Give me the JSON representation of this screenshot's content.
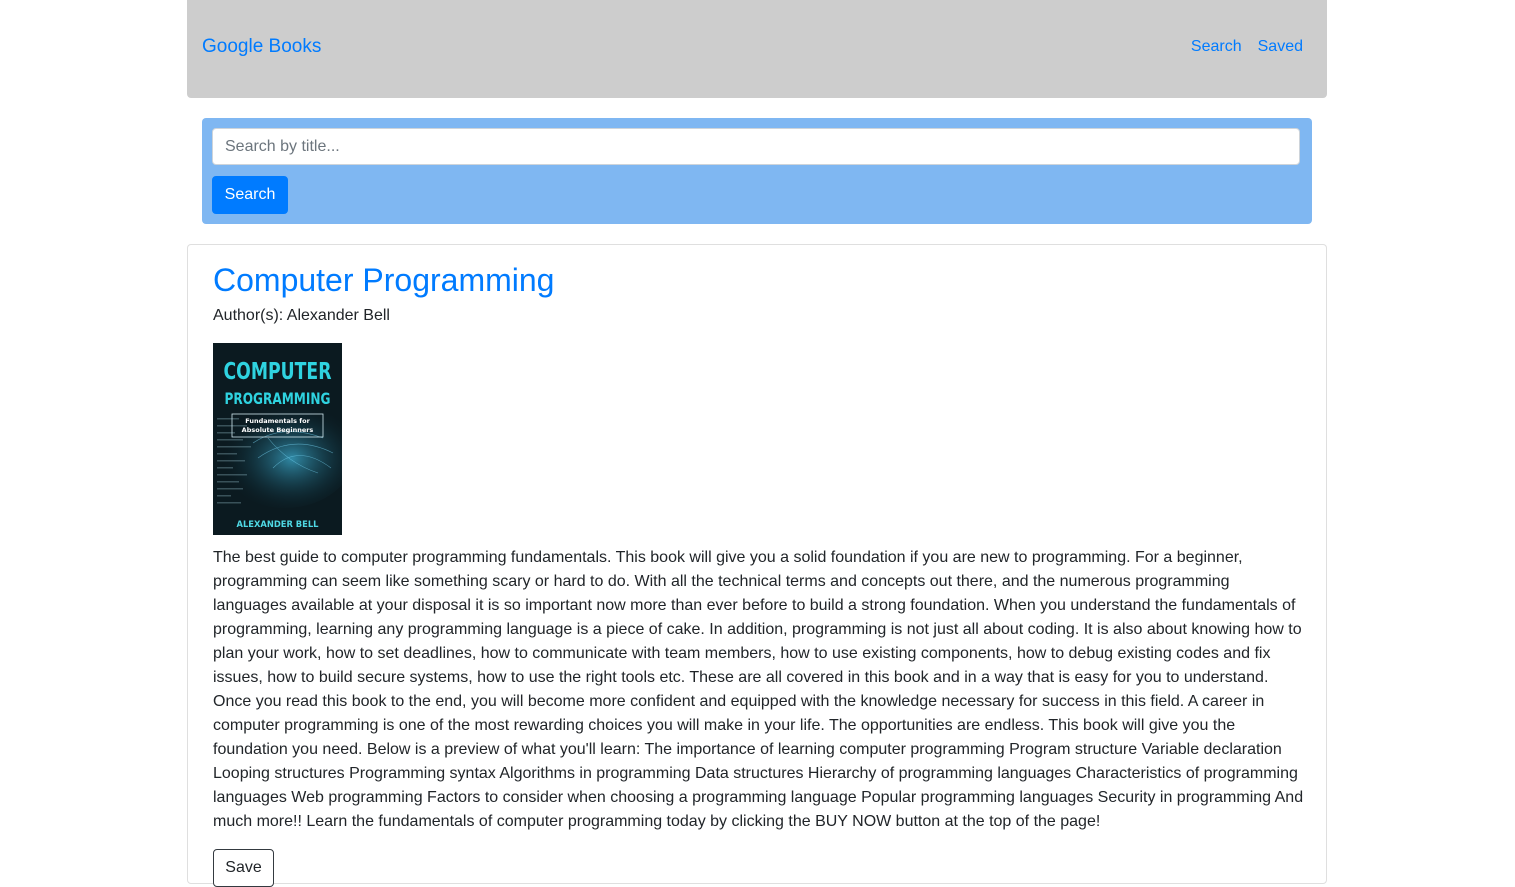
{
  "navbar": {
    "brand": "Google Books",
    "links": [
      "Search",
      "Saved"
    ]
  },
  "search": {
    "placeholder": "Search by title...",
    "value": "",
    "button_label": "Search"
  },
  "book": {
    "title": "Computer Programming",
    "author_line": "Author(s): Alexander Bell",
    "cover": {
      "title_line1": "COMPUTER",
      "title_line2": "PROGRAMMING",
      "subtitle_line1": "Fundamentals for",
      "subtitle_line2": "Absolute Beginners",
      "author": "ALEXANDER BELL"
    },
    "description": "The best guide to computer programming fundamentals. This book will give you a solid foundation if you are new to programming. For a beginner, programming can seem like something scary or hard to do. With all the technical terms and concepts out there, and the numerous programming languages available at your disposal it is so important now more than ever before to build a strong foundation. When you understand the fundamentals of programming, learning any programming language is a piece of cake. In addition, programming is not just all about coding. It is also about knowing how to plan your work, how to set deadlines, how to communicate with team members, how to use existing components, how to debug existing codes and fix issues, how to build secure systems, how to use the right tools etc. These are all covered in this book and in a way that is easy for you to understand. Once you read this book to the end, you will become more confident and equipped with the knowledge necessary for success in this field. A career in computer programming is one of the most rewarding choices you will make in your life. The opportunities are endless. This book will give you the foundation you need. Below is a preview of what you'll learn: The importance of learning computer programming Program structure Variable declaration Looping structures Programming syntax Algorithms in programming Data structures Hierarchy of programming languages Characteristics of programming languages Web programming Factors to consider when choosing a programming language Popular programming languages Security in programming And much more!! Learn the fundamentals of computer programming today by clicking the BUY NOW button at the top of the page!",
    "save_label": "Save"
  },
  "colors": {
    "link": "#007bff",
    "navbar_bg": "#cdcdcd",
    "search_panel_bg": "#7fb7f2",
    "primary_button": "#007bff",
    "cover_title": "#2fd3e0"
  }
}
